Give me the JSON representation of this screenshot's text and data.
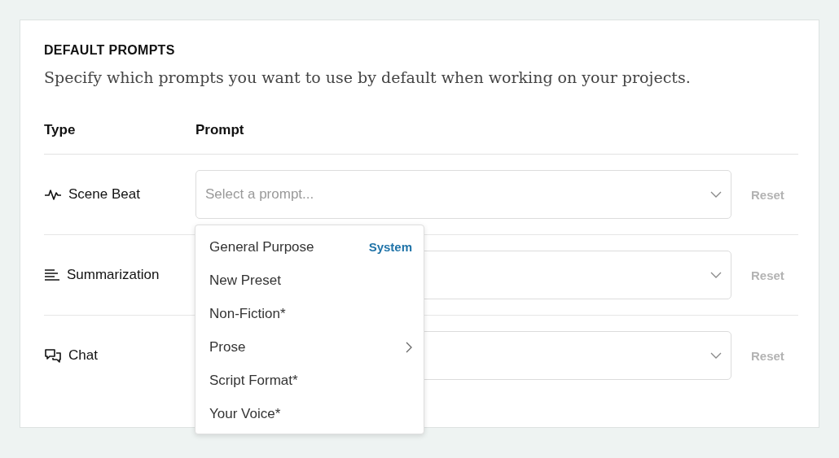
{
  "section": {
    "title": "DEFAULT PROMPTS",
    "description": "Specify which prompts you want to use by default when working on your projects."
  },
  "columns": [
    "Type",
    "Prompt"
  ],
  "rows": [
    {
      "type": "Scene Beat",
      "placeholder": "Select a prompt...",
      "expanded": true,
      "reset": {
        "label": "Reset",
        "disabled": true
      }
    },
    {
      "type": "Summarization",
      "expanded": false,
      "reset": {
        "label": "Reset",
        "disabled": true
      }
    },
    {
      "type": "Chat",
      "expanded": false,
      "reset": {
        "label": "Reset",
        "disabled": true
      }
    }
  ],
  "menu": {
    "items": [
      {
        "label": "General Purpose",
        "tag": "System",
        "submenu": false
      },
      {
        "label": "New Preset",
        "submenu": false
      },
      {
        "label": "Non-Fiction*",
        "submenu": false
      },
      {
        "label": "Prose",
        "submenu": true
      },
      {
        "label": "Script Format*",
        "submenu": false
      },
      {
        "label": "Your Voice*",
        "submenu": false
      }
    ]
  }
}
